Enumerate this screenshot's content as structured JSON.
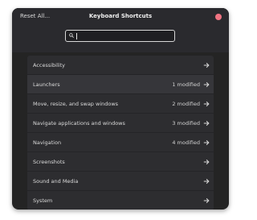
{
  "header": {
    "reset_label": "Reset All...",
    "title": "Keyboard Shortcuts",
    "close_color": "#f07482"
  },
  "search": {
    "value": "",
    "placeholder": "",
    "icon": "search-icon"
  },
  "categories": [
    {
      "label": "Accessibility",
      "status": ""
    },
    {
      "label": "Launchers",
      "status": "1 modified"
    },
    {
      "label": "Move, resize, and swap windows",
      "status": "2 modified"
    },
    {
      "label": "Navigate applications and windows",
      "status": "3 modified"
    },
    {
      "label": "Navigation",
      "status": "4 modified"
    },
    {
      "label": "Screenshots",
      "status": ""
    },
    {
      "label": "Sound and Media",
      "status": ""
    },
    {
      "label": "System",
      "status": ""
    }
  ],
  "row_icon": "arrow-right-icon"
}
